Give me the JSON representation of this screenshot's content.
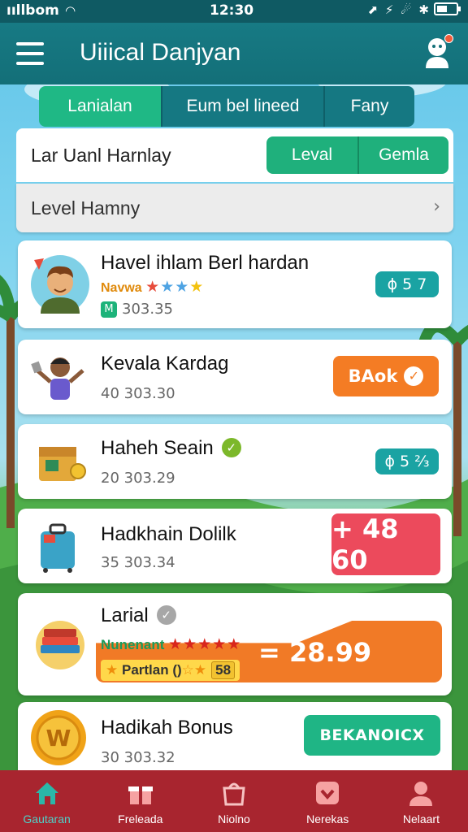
{
  "status_bar": {
    "carrier": "ııllbom",
    "time": "12:30",
    "icons": "⬈ ⚡ ☄ ✱"
  },
  "header": {
    "title": "Uiiical Danjyan"
  },
  "tabs": [
    {
      "label": "Lanialan"
    },
    {
      "label": "Eum bel lineed"
    },
    {
      "label": "Fany"
    }
  ],
  "filter": {
    "label": "Lar Uanl Harnlay",
    "options": [
      "Leval",
      "Gemla"
    ]
  },
  "level_row": {
    "label": "Level Hamny"
  },
  "items": [
    {
      "title": "Havel ihlam Berl hardan",
      "rating_label": "Navwa",
      "stars": "★★★★",
      "subtitle": "303.35",
      "price": "ɸ 5 7"
    },
    {
      "title": "Kevala Kardag",
      "subtitle": "40 303.30",
      "button": "BAok"
    },
    {
      "title": "Haheh Seain",
      "subtitle": "20 303.29",
      "price": "ɸ 5 ⅔"
    },
    {
      "title": "Hadkhain Dolilk",
      "subtitle": "35 303.34",
      "price": "+ 48 60"
    },
    {
      "title": "Larial",
      "rating_label": "Nunenant",
      "stars": "★★★★★",
      "offer_price": "= 28.99",
      "offer_tag": "Partlan ()",
      "offer_tag_stars": "☆★",
      "offer_badge": "58"
    },
    {
      "title": "Hadikah Bonus",
      "subtitle": "30 303.32",
      "button": "BEKANOICX",
      "coin": "W"
    }
  ],
  "bottom_nav": [
    {
      "label": "Gautaran",
      "icon": "home-icon"
    },
    {
      "label": "Freleada",
      "icon": "gift-icon"
    },
    {
      "label": "Niolno",
      "icon": "bag-icon"
    },
    {
      "label": "Nerekas",
      "icon": "heart-icon"
    },
    {
      "label": "Nelaart",
      "icon": "person-icon"
    }
  ],
  "colors": {
    "header": "#177a84",
    "accent_green": "#1fb585",
    "orange": "#f47c24",
    "red": "#ec4a5c",
    "nav": "#a8252f"
  }
}
